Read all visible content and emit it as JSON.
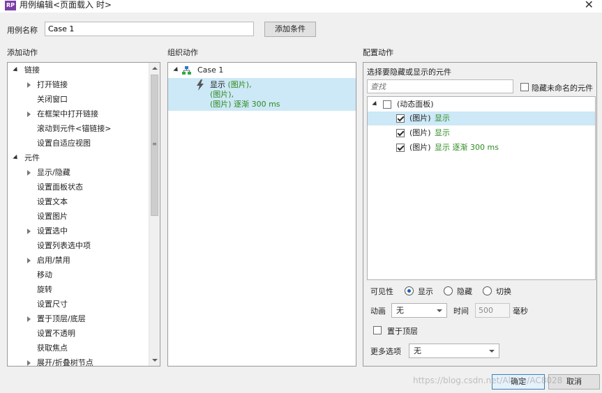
{
  "window": {
    "app_badge": "RP",
    "title": "用例编辑<页面载入 时>",
    "close_label": "✕"
  },
  "case": {
    "name_label": "用例名称",
    "name_value": "Case 1",
    "add_condition_label": "添加条件"
  },
  "sections": {
    "add_actions": "添加动作",
    "organize_actions": "组织动作",
    "configure_actions": "配置动作"
  },
  "add_actions_tree": [
    {
      "label": "链接",
      "kind": "group"
    },
    {
      "label": "打开链接",
      "kind": "expandable"
    },
    {
      "label": "关闭窗口",
      "kind": "leaf"
    },
    {
      "label": "在框架中打开链接",
      "kind": "expandable"
    },
    {
      "label": "滚动到元件<锚链接>",
      "kind": "leaf"
    },
    {
      "label": "设置自适应视图",
      "kind": "leaf"
    },
    {
      "label": "元件",
      "kind": "group"
    },
    {
      "label": "显示/隐藏",
      "kind": "expandable"
    },
    {
      "label": "设置面板状态",
      "kind": "leaf"
    },
    {
      "label": "设置文本",
      "kind": "leaf"
    },
    {
      "label": "设置图片",
      "kind": "leaf"
    },
    {
      "label": "设置选中",
      "kind": "expandable"
    },
    {
      "label": "设置列表选中项",
      "kind": "leaf"
    },
    {
      "label": "启用/禁用",
      "kind": "expandable"
    },
    {
      "label": "移动",
      "kind": "leaf"
    },
    {
      "label": "旋转",
      "kind": "leaf"
    },
    {
      "label": "设置尺寸",
      "kind": "leaf"
    },
    {
      "label": "置于顶层/底层",
      "kind": "expandable"
    },
    {
      "label": "设置不透明",
      "kind": "leaf"
    },
    {
      "label": "获取焦点",
      "kind": "leaf"
    },
    {
      "label": "展开/折叠树节点",
      "kind": "expandable"
    }
  ],
  "organize": {
    "case_label": "Case 1",
    "action_verb": "显示",
    "action_lines": [
      "(图片),",
      "(图片),",
      "(图片) 逐渐 300 ms"
    ]
  },
  "configure": {
    "select_prompt": "选择要隐藏或显示的元件",
    "search_placeholder": "查找",
    "hide_unnamed_label": "隐藏未命名的元件",
    "dynamic_panel_label": "(动态面板)",
    "widgets": [
      {
        "name": "(图片)",
        "action": "显示",
        "checked": true
      },
      {
        "name": "(图片)",
        "action": "显示",
        "checked": true
      },
      {
        "name": "(图片)",
        "action": "显示 逐渐 300 ms",
        "checked": true
      }
    ],
    "visibility_label": "可见性",
    "visibility_options": [
      "显示",
      "隐藏",
      "切换"
    ],
    "visibility_selected": "显示",
    "animation_label": "动画",
    "animation_value": "无",
    "time_label": "时间",
    "time_value": "500",
    "time_unit": "毫秒",
    "bring_to_front_label": "置于顶层",
    "more_options_label": "更多选项",
    "more_options_value": "无"
  },
  "footer": {
    "ok_label": "确定",
    "cancel_label": "取消"
  },
  "watermark": "https://blog.csdn.net/AlwYu/AC8028"
}
